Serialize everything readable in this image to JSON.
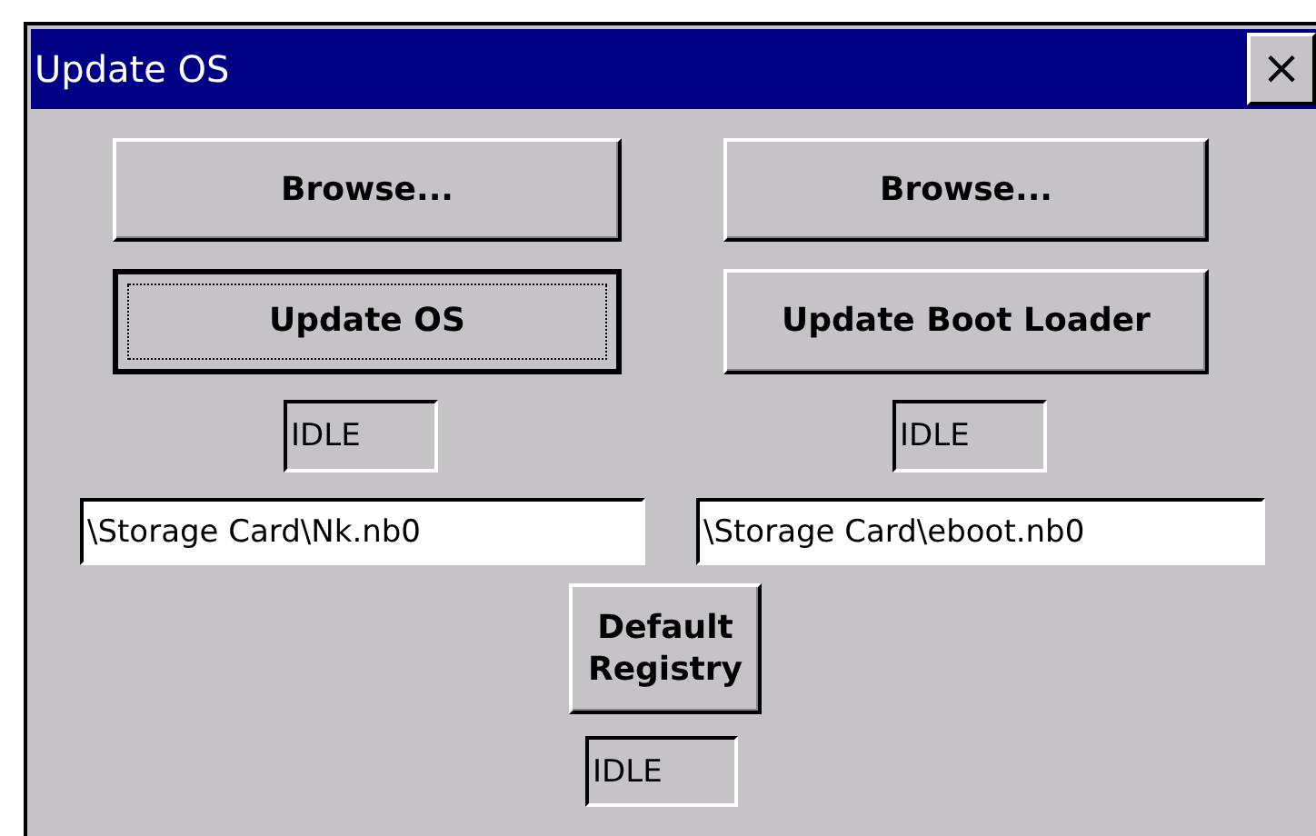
{
  "window": {
    "title": "Update OS",
    "close": "×"
  },
  "browse_buttons": [
    {
      "label": "Browse...",
      "focused": false
    },
    {
      "label": "Browse...",
      "focused": false
    }
  ],
  "update_buttons": [
    {
      "label": "Update OS",
      "focused": true
    },
    {
      "label": "Update Boot Loader",
      "focused": false
    }
  ],
  "status_fields": [
    {
      "value": "IDLE"
    },
    {
      "value": "IDLE"
    }
  ],
  "path_fields": [
    {
      "value": "\\Storage Card\\Nk.nb0"
    },
    {
      "value": "\\Storage Card\\eboot.nb0"
    }
  ],
  "registry_button": {
    "label": "Default Registry",
    "focused": false
  },
  "registry_status": {
    "value": "IDLE"
  }
}
